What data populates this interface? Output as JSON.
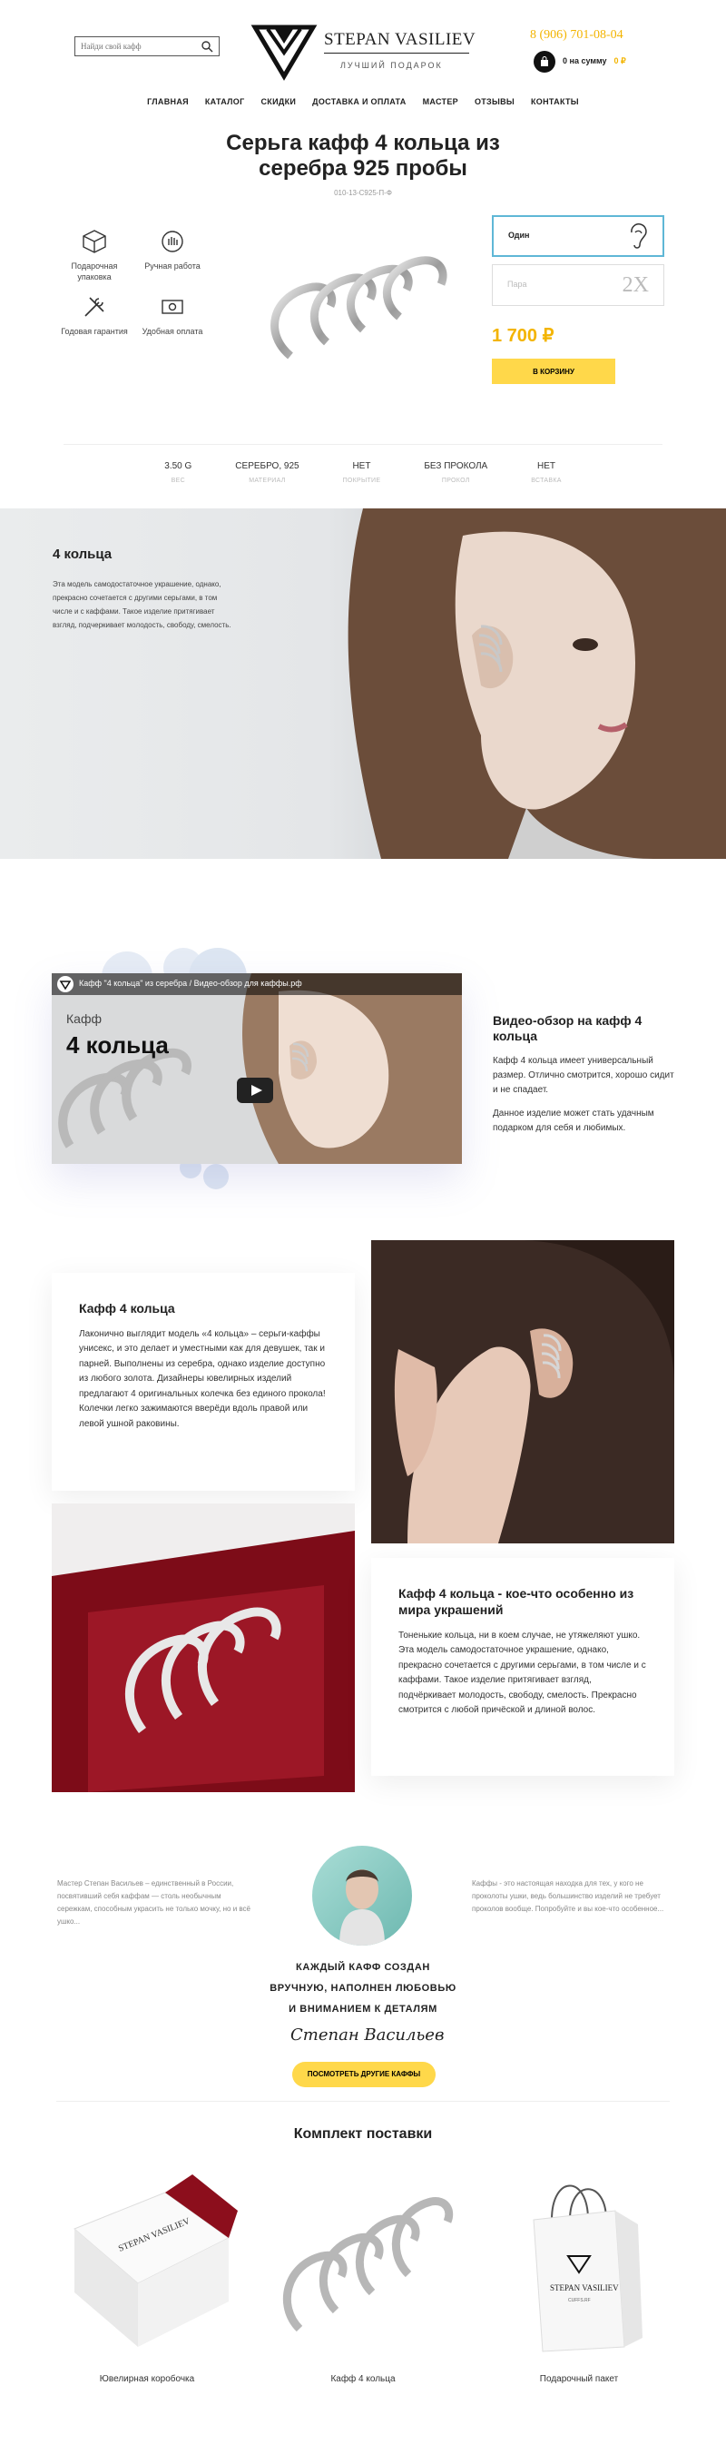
{
  "header": {
    "search_placeholder": "Найди свой кафф",
    "brand": "STEPAN VASILIEV",
    "tagline": "ЛУЧШИЙ ПОДАРОК",
    "phone": "8 (906) 701-08-04",
    "cart_label": "0 на сумму",
    "cart_amount": "0 ₽"
  },
  "nav": [
    "ГЛАВНАЯ",
    "КАТАЛОГ",
    "СКИДКИ",
    "ДОСТАВКА И ОПЛАТА",
    "МАСТЕР",
    "ОТЗЫВЫ",
    "КОНТАКТЫ"
  ],
  "product": {
    "title_line1": "Серьга кафф 4 кольца из",
    "title_line2": "серебра 925 пробы",
    "sku": "010-13-C925-П-Ф",
    "features": [
      {
        "label": "Подарочная упаковка",
        "icon": "box-icon"
      },
      {
        "label": "Ручная работа",
        "icon": "hand-icon"
      },
      {
        "label": "Годовая гарантия",
        "icon": "tools-icon"
      },
      {
        "label": "Удобная оплата",
        "icon": "money-icon"
      }
    ],
    "option_single": "Один",
    "option_pair": "Пара",
    "option_pair_mark": "2X",
    "price": "1 700 ₽",
    "buy_label": "В КОРЗИНУ",
    "specs": [
      {
        "value": "3.50 G",
        "key": "ВЕС"
      },
      {
        "value": "СЕРЕБРО, 925",
        "key": "МАТЕРИАЛ"
      },
      {
        "value": "НЕТ",
        "key": "ПОКРЫТИЕ"
      },
      {
        "value": "БЕЗ ПРОКОЛА",
        "key": "ПРОКОЛ"
      },
      {
        "value": "НЕТ",
        "key": "ВСТАВКА"
      }
    ]
  },
  "hero": {
    "title": "4 кольца",
    "text": "Эта модель самодостаточное украшение, однако, прекрасно сочетается с другими серьгами, в том числе и с каффами. Такое изделие притягивает взгляд, подчеркивает молодость, свободу, смелость."
  },
  "video": {
    "bar_title": "Кафф \"4 кольца\" из серебра / Видео-обзор для каффы.рф",
    "overlay_sub": "Кафф",
    "overlay_title": "4 кольца",
    "heading": "Видео-обзор на кафф 4 кольца",
    "p1": "Кафф 4 кольца имеет универсальный размер. Отлично смотрится, хорошо сидит и не спадает.",
    "p2": "Данное изделие может стать удачным подарком для себя и любимых."
  },
  "cards": {
    "c1_title": "Кафф 4 кольца",
    "c1_text": "Лаконично выглядит модель «4 кольца» – серьги-каффы унисекс, и это делает и уместными как для девушек, так и парней. Выполнены из серебра, однако изделие доступно из любого золота. Дизайнеры ювелирных изделий предлагают 4 оригинальных колечка без единого прокола! Колечки легко зажимаются вверёди вдоль правой или левой ушной раковины.",
    "c2_title": "Кафф 4 кольца - кое-что особенно из мира украшений",
    "c2_text": "Тоненькие кольца, ни в коем случае, не утяжеляют ушко. Эта модель самодостаточное украшение, однако, прекрасно сочетается с другими серьгами, в том числе и с каффами. Такое изделие притягивает взгляд, подчёркивает молодость, свободу, смелость. Прекрасно смотрится с любой причёской и длиной волос."
  },
  "master": {
    "left": "Мастер Степан Васильев – единственный в России, посвятивший себя каффам — столь необычным сережкам, способным украсить не только мочку, но и всё ушко...",
    "right": "Каффы - это настоящая находка для тех, у кого не проколоты ушки, ведь большинство изделий не требует проколов вообще. Попробуйте и вы кое-что особенное...",
    "slogan1": "КАЖДЫЙ КАФФ СОЗДАН",
    "slogan2": "ВРУЧНУЮ, НАПОЛНЕН ЛЮБОВЬЮ",
    "slogan3": "И ВНИМАНИЕМ К ДЕТАЛЯМ",
    "signature": "Степан Васильев",
    "button": "ПОСМОТРЕТЬ ДРУГИЕ КАФФЫ"
  },
  "kit": {
    "title": "Комплект поставки",
    "items": [
      "Ювелирная коробочка",
      "Кафф 4 кольца",
      "Подарочный пакет"
    ],
    "box_brand": "STEPAN VASILIEV",
    "box_site": "CUFFS.RF"
  },
  "colors": {
    "accent": "#ffd84a",
    "price": "#f3b400",
    "selected": "#5fb7d6"
  }
}
